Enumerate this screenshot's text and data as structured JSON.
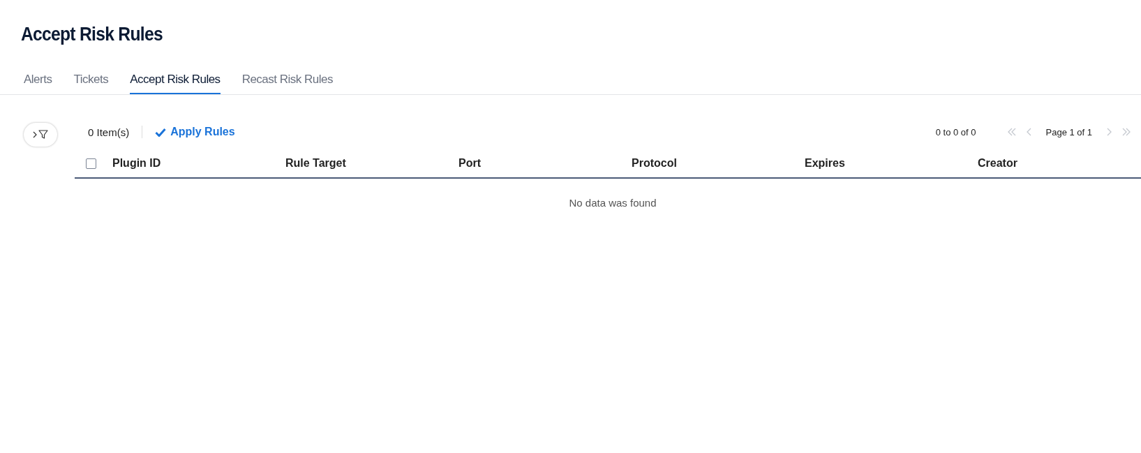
{
  "page": {
    "title": "Accept Risk Rules"
  },
  "tabs": [
    {
      "label": "Alerts",
      "selected": false
    },
    {
      "label": "Tickets",
      "selected": false
    },
    {
      "label": "Accept Risk Rules",
      "selected": true
    },
    {
      "label": "Recast Risk Rules",
      "selected": false
    }
  ],
  "toolbar": {
    "filter_panel_expanded": false,
    "item_count": "0 Item(s)",
    "apply_button": "Apply Rules"
  },
  "pagination": {
    "range": "0 to 0 of 0",
    "page_label": "Page 1 of 1",
    "first_disabled": true,
    "prev_disabled": true,
    "next_disabled": true,
    "last_disabled": true
  },
  "table": {
    "select_all_checked": false,
    "columns": [
      "Plugin ID",
      "Rule Target",
      "Port",
      "Protocol",
      "Expires",
      "Creator"
    ],
    "empty_message": "No data was found"
  }
}
